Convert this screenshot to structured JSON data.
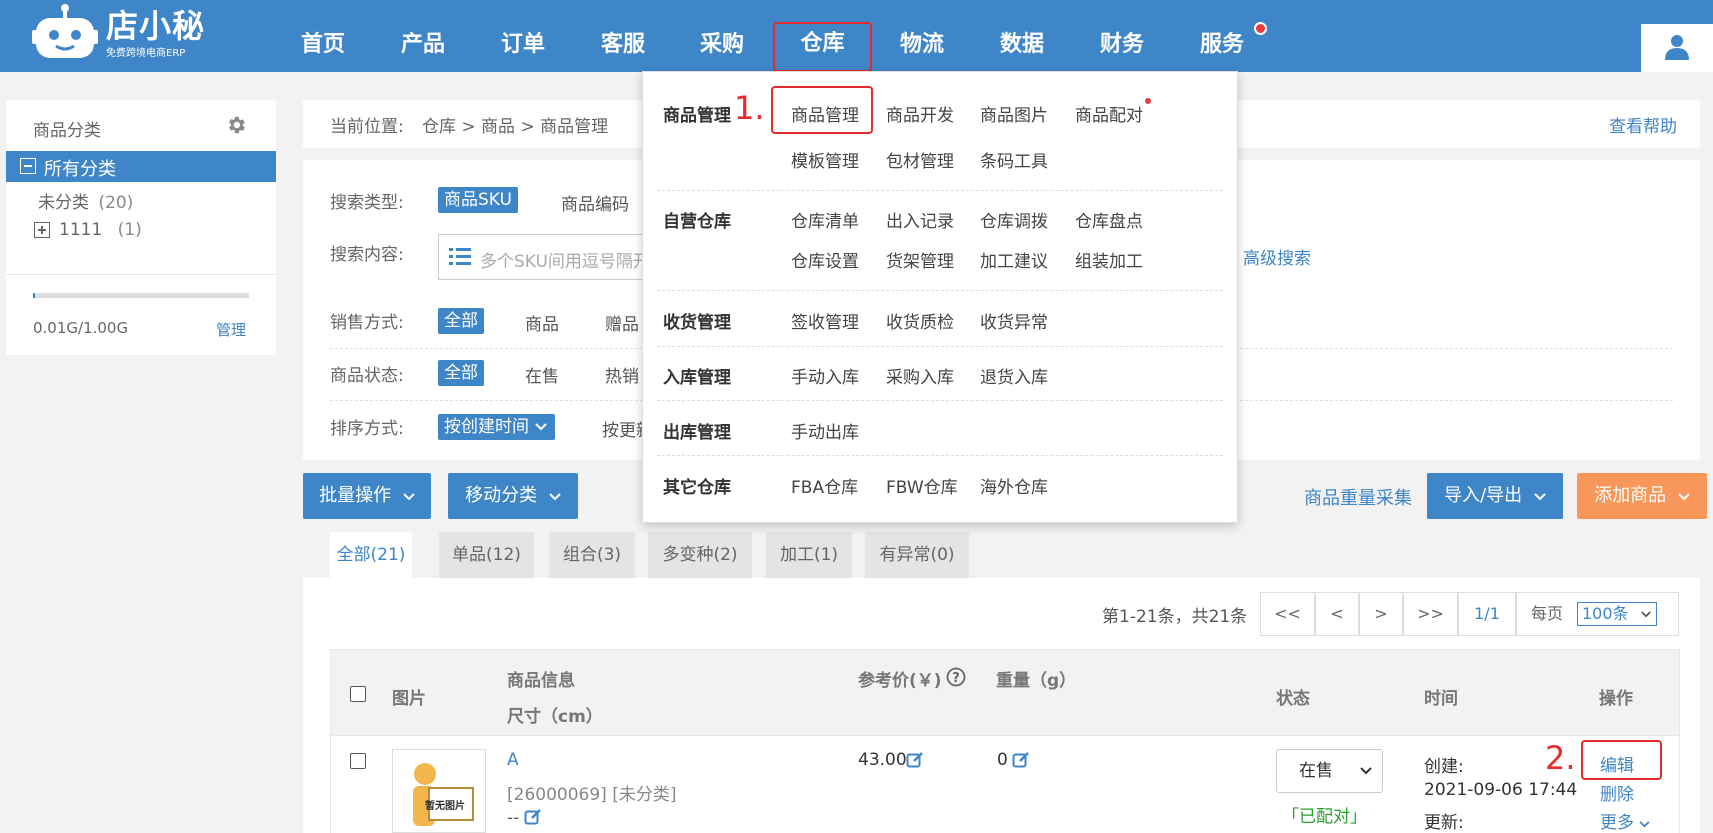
{
  "logo": {
    "name": "店小秘",
    "subtitle": "免费跨境电商ERP"
  },
  "nav": [
    "首页",
    "产品",
    "订单",
    "客服",
    "采购",
    "仓库",
    "物流",
    "数据",
    "财务",
    "服务"
  ],
  "sidebar": {
    "title": "商品分类",
    "all": "所有分类",
    "uncategorized": "未分类",
    "uncategorized_count": "(20)",
    "folder": "1111",
    "folder_count": "(1)",
    "storage": "0.01G/1.00G",
    "storage_fraction": 0.01,
    "manage": "管理"
  },
  "breadcrumb": {
    "label": "当前位置:",
    "path": "仓库 > 商品 > 商品管理",
    "help": "查看帮助"
  },
  "filters": {
    "search_type_label": "搜索类型:",
    "search_type_active": "商品SKU",
    "search_type_other": "商品编码",
    "search_content_label": "搜索内容:",
    "search_placeholder": "多个SKU间用逗号隔开",
    "advanced": "高级搜索",
    "sale_label": "销售方式:",
    "sale_active": "全部",
    "sale_1": "商品",
    "sale_2": "赠品",
    "status_label": "商品状态:",
    "status_active": "全部",
    "status_1": "在售",
    "status_2": "热销",
    "sort_label": "排序方式:",
    "sort_active": "按创建时间",
    "sort_other": "按更新"
  },
  "toolbar": {
    "batch": "批量操作",
    "move": "移动分类",
    "weight": "商品重量采集",
    "import": "导入/导出",
    "add": "添加商品"
  },
  "tabs": [
    "全部(21)",
    "单品(12)",
    "组合(3)",
    "多变种(2)",
    "加工(1)",
    "有异常(0)"
  ],
  "pagination": {
    "summary": "第1-21条，共21条",
    "first": "<<",
    "prev": "<",
    "next": ">",
    "last": ">>",
    "page": "1/1",
    "per_page_label": "每页",
    "per_page": "100条"
  },
  "table": {
    "headers": {
      "image": "图片",
      "info": "商品信息",
      "size": "尺寸（cm）",
      "price": "参考价(￥)",
      "weight": "重量（g）",
      "status": "状态",
      "time": "时间",
      "ops": "操作"
    },
    "row": {
      "no_image": "暂无图片",
      "name": "A",
      "sku": "[26000069]",
      "category": "[未分类]",
      "size": "--",
      "price": "43.00",
      "weight": "0",
      "status": "在售",
      "paired": "「已配对」",
      "created_label": "创建:",
      "created": "2021-09-06 17:44",
      "updated_label": "更新:",
      "edit": "编辑",
      "delete": "删除",
      "more": "更多"
    }
  },
  "dropdown": {
    "g1": "商品管理",
    "g1_items": [
      "商品管理",
      "商品开发",
      "商品图片",
      "商品配对",
      "模板管理",
      "包材管理",
      "条码工具"
    ],
    "g2": "自营仓库",
    "g2_items": [
      "仓库清单",
      "出入记录",
      "仓库调拨",
      "仓库盘点",
      "仓库设置",
      "货架管理",
      "加工建议",
      "组装加工"
    ],
    "g3": "收货管理",
    "g3_items": [
      "签收管理",
      "收货质检",
      "收货异常"
    ],
    "g4": "入库管理",
    "g4_items": [
      "手动入库",
      "采购入库",
      "退货入库"
    ],
    "g5": "出库管理",
    "g5_items": [
      "手动出库"
    ],
    "g6": "其它仓库",
    "g6_items": [
      "FBA仓库",
      "FBW仓库",
      "海外仓库"
    ]
  },
  "annotations": {
    "step1": "1.",
    "step2": "2."
  }
}
